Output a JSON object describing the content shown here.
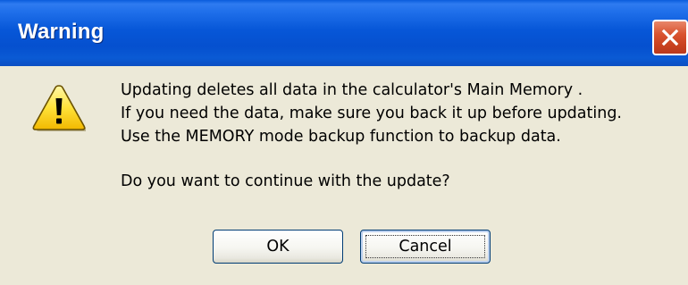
{
  "window": {
    "title": "Warning",
    "close_icon": "close-icon"
  },
  "dialog": {
    "icon": "warning-icon",
    "message_lines": [
      "Updating deletes all data in the calculator's Main Memory .",
      "If you need the data, make sure you back it up before updating.",
      "Use the MEMORY mode backup function to backup data."
    ],
    "question": "Do you want to continue with the update?"
  },
  "buttons": {
    "ok_label": "OK",
    "cancel_label": "Cancel"
  },
  "colors": {
    "titlebar": "#0757d8",
    "close_button": "#d9532f",
    "face": "#ece9d8",
    "button_border": "#003c74"
  }
}
